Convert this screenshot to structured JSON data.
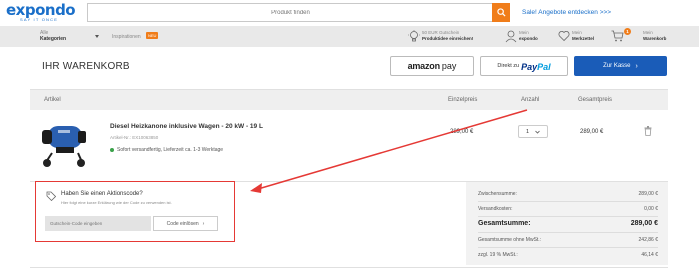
{
  "header": {
    "logo_main": "expondo",
    "logo_sub": "SAY IT ONCE",
    "search_placeholder": "Produkt finden",
    "sale_link": "Sale! Angebote entdecken >>>"
  },
  "nav": {
    "categories_small": "Alle",
    "categories_big": "Kategorien",
    "inspiration": "Inspirationen",
    "inspiration_badge": "NEU",
    "idea_small": "50 EUR Gutschein",
    "idea_big": "Produktidee einreichen!",
    "account_small": "Mein",
    "account_big": "expondo",
    "wishlist_small": "Mein",
    "wishlist_big": "Merkzettel",
    "cart_small": "Mein",
    "cart_big": "Warenkorb",
    "cart_count": "1"
  },
  "cart": {
    "title": "IHR WARENKORB",
    "amazon_label": "amazon",
    "amazon_pay": "pay",
    "paypal_prefix": "Direkt zu",
    "paypal_pay": "Pay",
    "paypal_pal": "Pal",
    "checkout_label": "Zur Kasse"
  },
  "table": {
    "headers": [
      "Artikel",
      "Einzelpreis",
      "Anzahl",
      "Gesamtpreis"
    ]
  },
  "product": {
    "name": "Diesel Heizkanone inklusive Wagen - 20 kW - 19 L",
    "article_no": "Artikel-Nr.: EX10063850",
    "stock": "Sofort versandfertig, Lieferzeit ca. 1-3 Werktage",
    "unit_price": "289,00 €",
    "quantity": "1",
    "total_price": "289,00 €"
  },
  "promo": {
    "title": "Haben Sie einen Aktionscode?",
    "subtitle": "Hier folgt eine kurze Erklärung wie der Code zu verwenden ist.",
    "input_placeholder": "Gutschein-Code eingeben",
    "button_label": "Code einlösen"
  },
  "summary": {
    "rows": [
      {
        "label": "Zwischensumme:",
        "value": "289,00 €"
      },
      {
        "label": "Versandkosten:",
        "value": "0,00 €"
      },
      {
        "label": "Gesamtsumme:",
        "value": "289,00 €"
      },
      {
        "label": "Gesamtsumme ohne MwSt.:",
        "value": "242,86 €"
      },
      {
        "label": "zzgl. 19 % MwSt.:",
        "value": "46,14 €"
      }
    ]
  },
  "colors": {
    "brand": "#1a6fc9",
    "accent": "#f07d1a",
    "checkout": "#1a5cb8",
    "highlight": "#e53935"
  }
}
